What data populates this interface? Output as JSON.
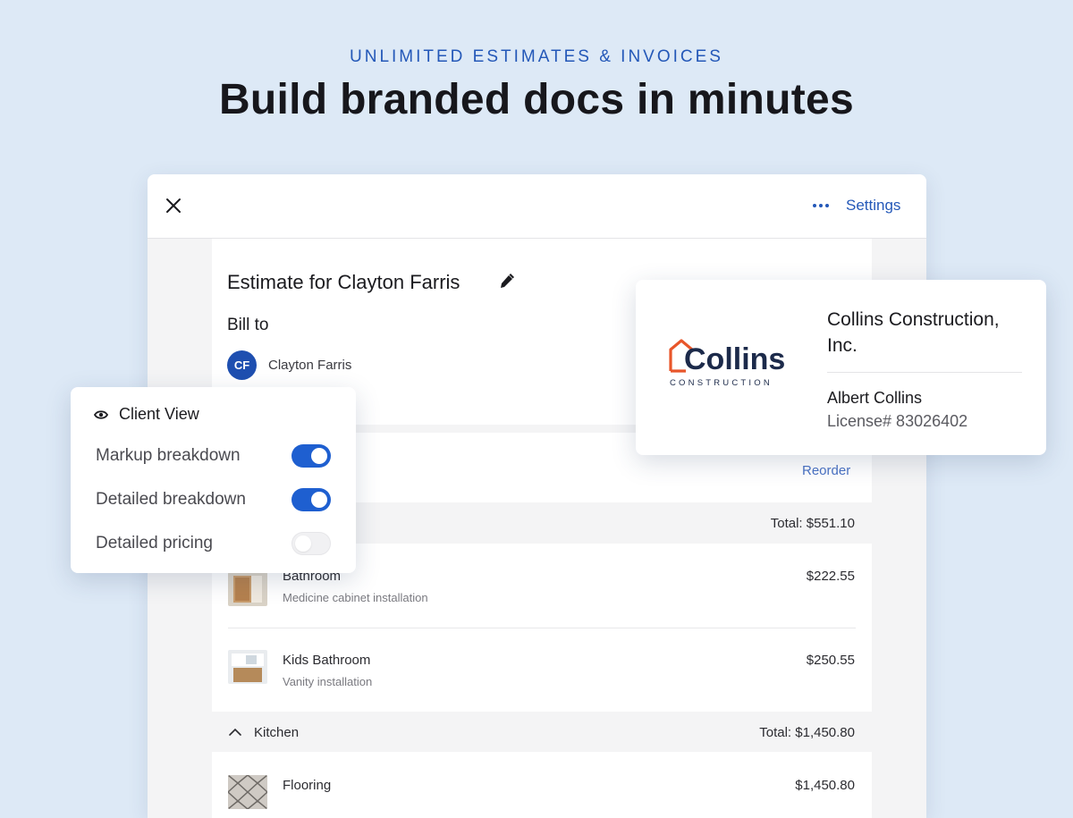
{
  "hero": {
    "eyebrow": "UNLIMITED ESTIMATES & INVOICES",
    "headline": "Build branded docs in minutes"
  },
  "toolbar": {
    "settings_label": "Settings"
  },
  "estimate": {
    "title": "Estimate for Clayton Farris",
    "bill_to_label": "Bill to",
    "client_initials": "CF",
    "client_name": "Clayton Farris",
    "reorder_label": "Reorder",
    "section_total": "Total: $551.10",
    "items": [
      {
        "name": "Bathroom",
        "desc": "Medicine cabinet installation",
        "price": "$222.55"
      },
      {
        "name": "Kids Bathroom",
        "desc": "Vanity installation",
        "price": "$250.55"
      }
    ],
    "kitchen": {
      "label": "Kitchen",
      "total": "Total: $1,450.80",
      "items": [
        {
          "name": "Flooring",
          "price": "$1,450.80"
        }
      ]
    }
  },
  "client_view": {
    "title": "Client View",
    "options": [
      {
        "label": "Markup breakdown",
        "enabled": true
      },
      {
        "label": "Detailed breakdown",
        "enabled": true
      },
      {
        "label": "Detailed pricing",
        "enabled": false
      }
    ]
  },
  "company": {
    "logo_text": "Collins",
    "logo_subtext": "CONSTRUCTION",
    "name": "Collins Construction, Inc.",
    "owner": "Albert Collins",
    "license": "License# 83026402"
  },
  "colors": {
    "accent": "#2458b8",
    "toggle_on": "#1e5fd0",
    "logo_orange": "#e8562a",
    "logo_navy": "#1c2a4a"
  }
}
